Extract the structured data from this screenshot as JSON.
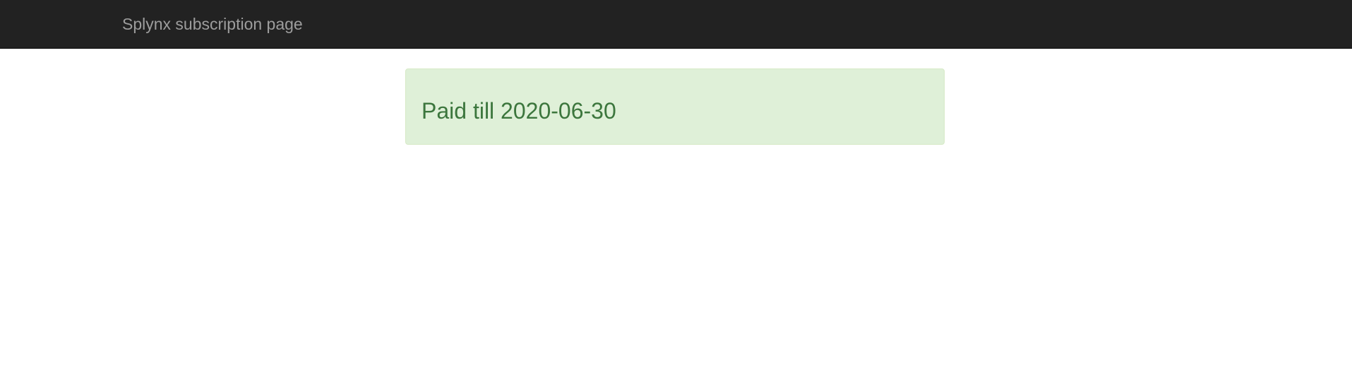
{
  "navbar": {
    "brand": "Splynx subscription page"
  },
  "alert": {
    "message": "Paid till 2020-06-30",
    "status": "success"
  },
  "colors": {
    "navbar_bg": "#222222",
    "brand_text": "#9d9d9d",
    "alert_bg": "#dff0d8",
    "alert_border": "#d6e9c6",
    "alert_text": "#3c763d"
  }
}
